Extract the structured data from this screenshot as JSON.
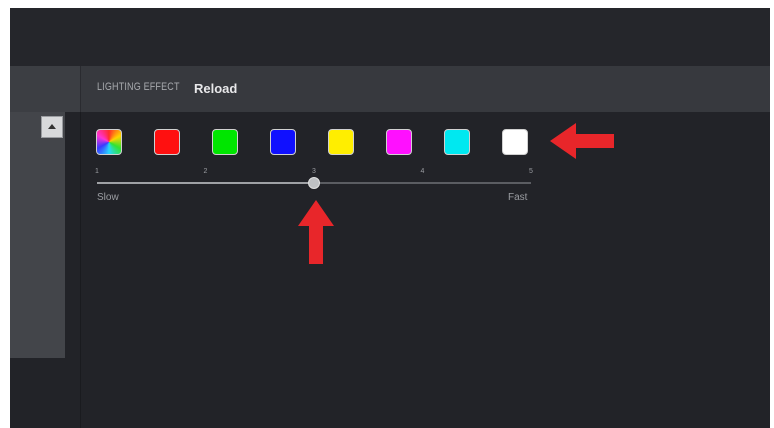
{
  "header": {
    "section_label": "LIGHTING EFFECT",
    "effect_value": "Reload"
  },
  "colors": {
    "app_bg": "#222328",
    "header_bg": "#37393e",
    "annotation_arrow": "#e8262a"
  },
  "color_swatches": [
    {
      "name": "multicolor",
      "color": "conic"
    },
    {
      "name": "red",
      "color": "#ff1010"
    },
    {
      "name": "green",
      "color": "#00e600"
    },
    {
      "name": "blue",
      "color": "#1010ff"
    },
    {
      "name": "yellow",
      "color": "#ffee00"
    },
    {
      "name": "magenta",
      "color": "#ff10ff"
    },
    {
      "name": "cyan",
      "color": "#00e8f0"
    },
    {
      "name": "white",
      "color": "#ffffff"
    }
  ],
  "speed_slider": {
    "ticks": [
      "1",
      "2",
      "3",
      "4",
      "5"
    ],
    "value": 3,
    "min_label": "Slow",
    "max_label": "Fast"
  }
}
